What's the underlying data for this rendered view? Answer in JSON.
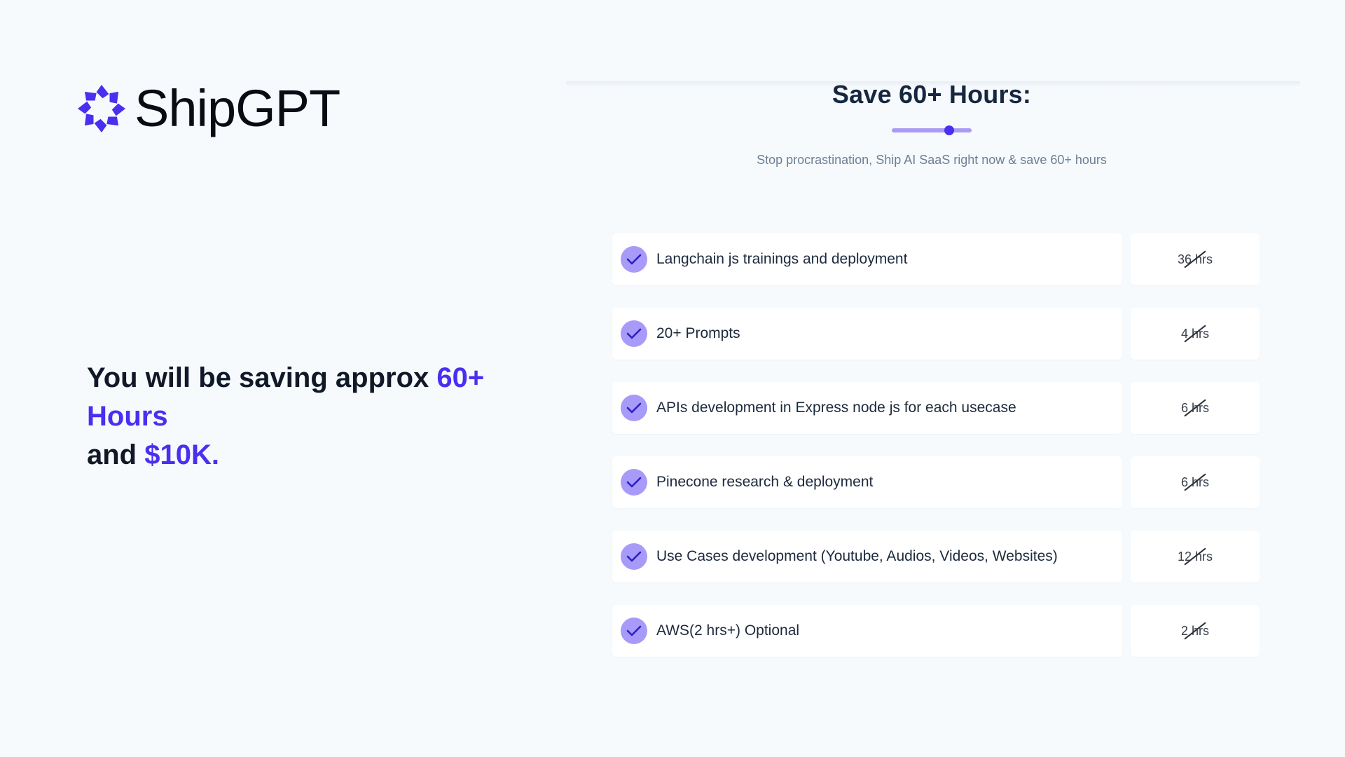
{
  "brand": {
    "name": "ShipGPT",
    "icon": "shipgpt-logo-icon",
    "accent_color": "#4a2ff0"
  },
  "headline": {
    "prefix": "You will be saving approx ",
    "hours": "60+ Hours",
    "middle": " and ",
    "money": "$10K."
  },
  "panel": {
    "title": "Save 60+ Hours:",
    "subtitle": "Stop procrastination, Ship AI SaaS right now & save 60+ hours",
    "slider_color": "#a99bf5",
    "knob_color": "#4a2ff0"
  },
  "features": [
    {
      "label": "Langchain js trainings and deployment",
      "hours": "36 hrs",
      "icon": "check-icon"
    },
    {
      "label": "20+ Prompts",
      "hours": "4 hrs",
      "icon": "check-icon"
    },
    {
      "label": "APIs development in Express node js for each usecase",
      "hours": "6 hrs",
      "icon": "check-icon"
    },
    {
      "label": "Pinecone research & deployment",
      "hours": "6 hrs",
      "icon": "check-icon"
    },
    {
      "label": "Use Cases development (Youtube, Audios, Videos, Websites)",
      "hours": "12 hrs",
      "icon": "check-icon"
    },
    {
      "label": "AWS(2 hrs+) Optional",
      "hours": "2 hrs",
      "icon": "check-icon"
    }
  ]
}
